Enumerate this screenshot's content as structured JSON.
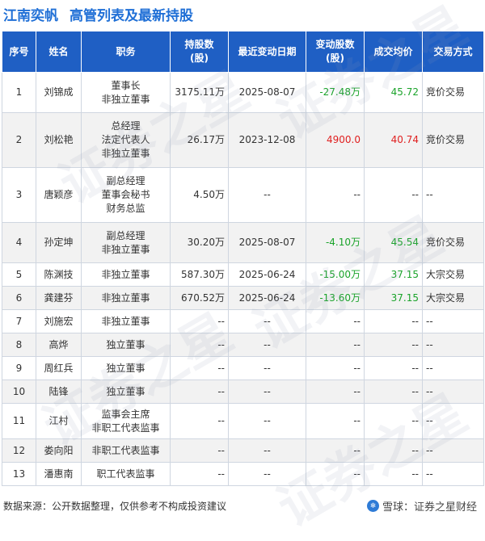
{
  "header": {
    "company": "江南奕帆",
    "title": "高管列表及最新持股"
  },
  "columns": [
    "序号",
    "姓名",
    "职务",
    "持股数\n(股)",
    "最近变动日期",
    "变动股数\n(股)",
    "成交均价",
    "交易方式"
  ],
  "rows": [
    {
      "no": "1",
      "name": "刘锦成",
      "position": [
        "董事长",
        "非独立董事"
      ],
      "holding": "3175.11万",
      "date": "2025-08-07",
      "change": "-27.48万",
      "change_dir": "neg",
      "price": "45.72",
      "price_dir": "neg",
      "method": "竞价交易"
    },
    {
      "no": "2",
      "name": "刘松艳",
      "position": [
        "总经理",
        "法定代表人",
        "非独立董事"
      ],
      "holding": "26.17万",
      "date": "2023-12-08",
      "change": "4900.0",
      "change_dir": "pos",
      "price": "40.74",
      "price_dir": "pos",
      "method": "竞价交易"
    },
    {
      "no": "3",
      "name": "唐颖彦",
      "position": [
        "副总经理",
        "董事会秘书",
        "财务总监"
      ],
      "holding": "4.50万",
      "date": "--",
      "change": "--",
      "change_dir": "",
      "price": "--",
      "price_dir": "",
      "method": "--"
    },
    {
      "no": "4",
      "name": "孙定坤",
      "position": [
        "副总经理",
        "非独立董事"
      ],
      "holding": "30.20万",
      "date": "2025-08-07",
      "change": "-4.10万",
      "change_dir": "neg",
      "price": "45.54",
      "price_dir": "neg",
      "method": "竞价交易"
    },
    {
      "no": "5",
      "name": "陈渊技",
      "position": [
        "非独立董事"
      ],
      "holding": "587.30万",
      "date": "2025-06-24",
      "change": "-15.00万",
      "change_dir": "neg",
      "price": "37.15",
      "price_dir": "neg",
      "method": "大宗交易"
    },
    {
      "no": "6",
      "name": "龚建芬",
      "position": [
        "非独立董事"
      ],
      "holding": "670.52万",
      "date": "2025-06-24",
      "change": "-13.60万",
      "change_dir": "neg",
      "price": "37.15",
      "price_dir": "neg",
      "method": "大宗交易"
    },
    {
      "no": "7",
      "name": "刘施宏",
      "position": [
        "非独立董事"
      ],
      "holding": "--",
      "date": "--",
      "change": "--",
      "change_dir": "",
      "price": "--",
      "price_dir": "",
      "method": "--"
    },
    {
      "no": "8",
      "name": "高烨",
      "position": [
        "独立董事"
      ],
      "holding": "--",
      "date": "--",
      "change": "--",
      "change_dir": "",
      "price": "--",
      "price_dir": "",
      "method": "--"
    },
    {
      "no": "9",
      "name": "周红兵",
      "position": [
        "独立董事"
      ],
      "holding": "--",
      "date": "--",
      "change": "--",
      "change_dir": "",
      "price": "--",
      "price_dir": "",
      "method": "--"
    },
    {
      "no": "10",
      "name": "陆锋",
      "position": [
        "独立董事"
      ],
      "holding": "--",
      "date": "--",
      "change": "--",
      "change_dir": "",
      "price": "--",
      "price_dir": "",
      "method": "--"
    },
    {
      "no": "11",
      "name": "江村",
      "position": [
        "监事会主席",
        "非职工代表监事"
      ],
      "holding": "--",
      "date": "--",
      "change": "--",
      "change_dir": "",
      "price": "--",
      "price_dir": "",
      "method": "--"
    },
    {
      "no": "12",
      "name": "娄向阳",
      "position": [
        "非职工代表监事"
      ],
      "holding": "--",
      "date": "--",
      "change": "--",
      "change_dir": "",
      "price": "--",
      "price_dir": "",
      "method": "--"
    },
    {
      "no": "13",
      "name": "潘惠南",
      "position": [
        "职工代表监事"
      ],
      "holding": "--",
      "date": "--",
      "change": "--",
      "change_dir": "",
      "price": "--",
      "price_dir": "",
      "method": "--"
    }
  ],
  "footer": {
    "source": "数据来源：公开数据整理，仅供参考不构成投资建议",
    "brand": "雪球：证券之星财经"
  },
  "watermark_text": "证券之星",
  "colors": {
    "accent": "#1f5fc4",
    "title": "#1f6fd6",
    "negative": "#1aa32a",
    "positive": "#e02020"
  }
}
